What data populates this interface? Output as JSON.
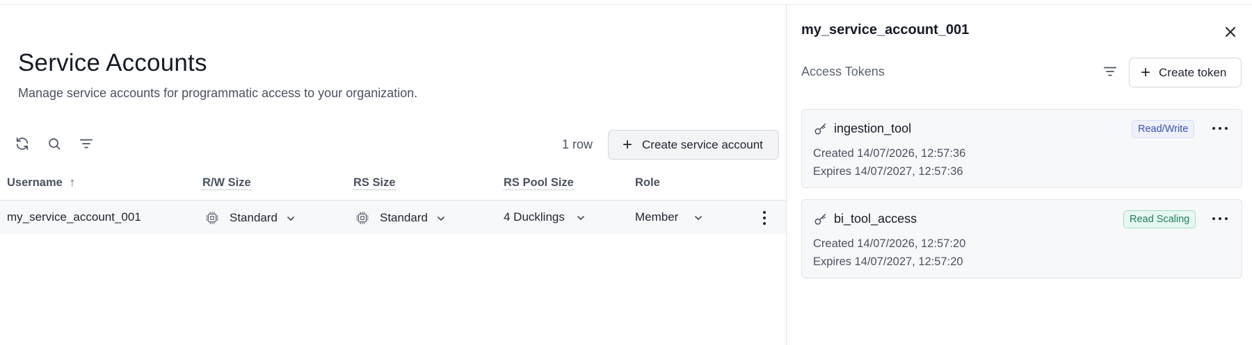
{
  "main": {
    "title": "Service Accounts",
    "subtitle": "Manage service accounts for programmatic access to your organization.",
    "row_count": "1 row",
    "create_button": "Create service account",
    "toolbar_icons": [
      "refresh-icon",
      "search-icon",
      "filter-icon"
    ],
    "table": {
      "columns": [
        "Username",
        "R/W Size",
        "RS Size",
        "RS Pool Size",
        "Role"
      ],
      "sort": {
        "column": "Username",
        "direction": "ascending"
      },
      "rows": [
        {
          "username": "my_service_account_001",
          "rw_size": "Standard",
          "rs_size": "Standard",
          "rs_pool_size": "4 Ducklings",
          "role": "Member"
        }
      ]
    }
  },
  "panel": {
    "title": "my_service_account_001",
    "section_label": "Access Tokens",
    "create_button": "Create token",
    "tokens": [
      {
        "name": "ingestion_tool",
        "badge": "Read/Write",
        "created": "Created 14/07/2026, 12:57:36",
        "expires": "Expires 14/07/2027, 12:57:36"
      },
      {
        "name": "bi_tool_access",
        "badge": "Read Scaling",
        "created": "Created 14/07/2026, 12:57:20",
        "expires": "Expires 14/07/2027, 12:57:20"
      }
    ]
  },
  "colors": {
    "read_write_badge": "#3b4fb3",
    "read_scaling_badge": "#1f7d5c",
    "row_highlight": "#f7f8f9"
  }
}
